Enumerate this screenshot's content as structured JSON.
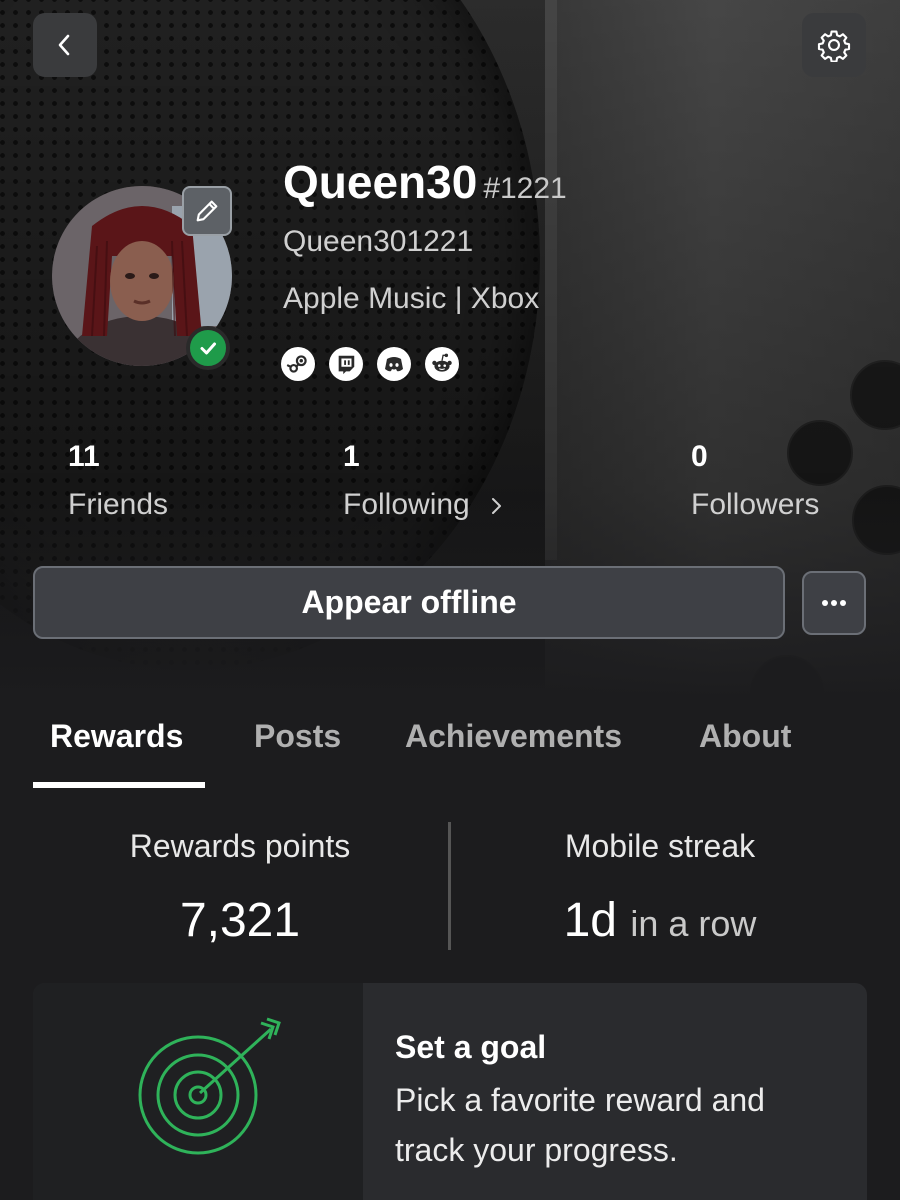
{
  "profile": {
    "gamertag": "Queen30",
    "suffix": "#1221",
    "real_name": "Queen301221",
    "bio": "Apple Music | Xbox",
    "status": "online"
  },
  "social_links": [
    {
      "icon": "steam-icon"
    },
    {
      "icon": "twitch-icon"
    },
    {
      "icon": "discord-icon"
    },
    {
      "icon": "reddit-icon"
    }
  ],
  "stats": {
    "friends": {
      "count": "11",
      "label": "Friends"
    },
    "following": {
      "count": "1",
      "label": "Following"
    },
    "followers": {
      "count": "0",
      "label": "Followers"
    }
  },
  "actions": {
    "primary_label": "Appear offline"
  },
  "tabs": [
    {
      "label": "Rewards",
      "active": true
    },
    {
      "label": "Posts",
      "active": false
    },
    {
      "label": "Achievements",
      "active": false
    },
    {
      "label": "About",
      "active": false
    }
  ],
  "rewards": {
    "points_label": "Rewards points",
    "points_value": "7,321",
    "streak_label": "Mobile streak",
    "streak_value": "1d",
    "streak_suffix": "in a row"
  },
  "goal_card": {
    "title": "Set a goal",
    "description": "Pick a favorite reward and track your progress."
  },
  "colors": {
    "background": "#1c1c1e",
    "online_green": "#1f9b4a",
    "target_green": "#2fb35a",
    "button_bg": "#3e4045"
  }
}
